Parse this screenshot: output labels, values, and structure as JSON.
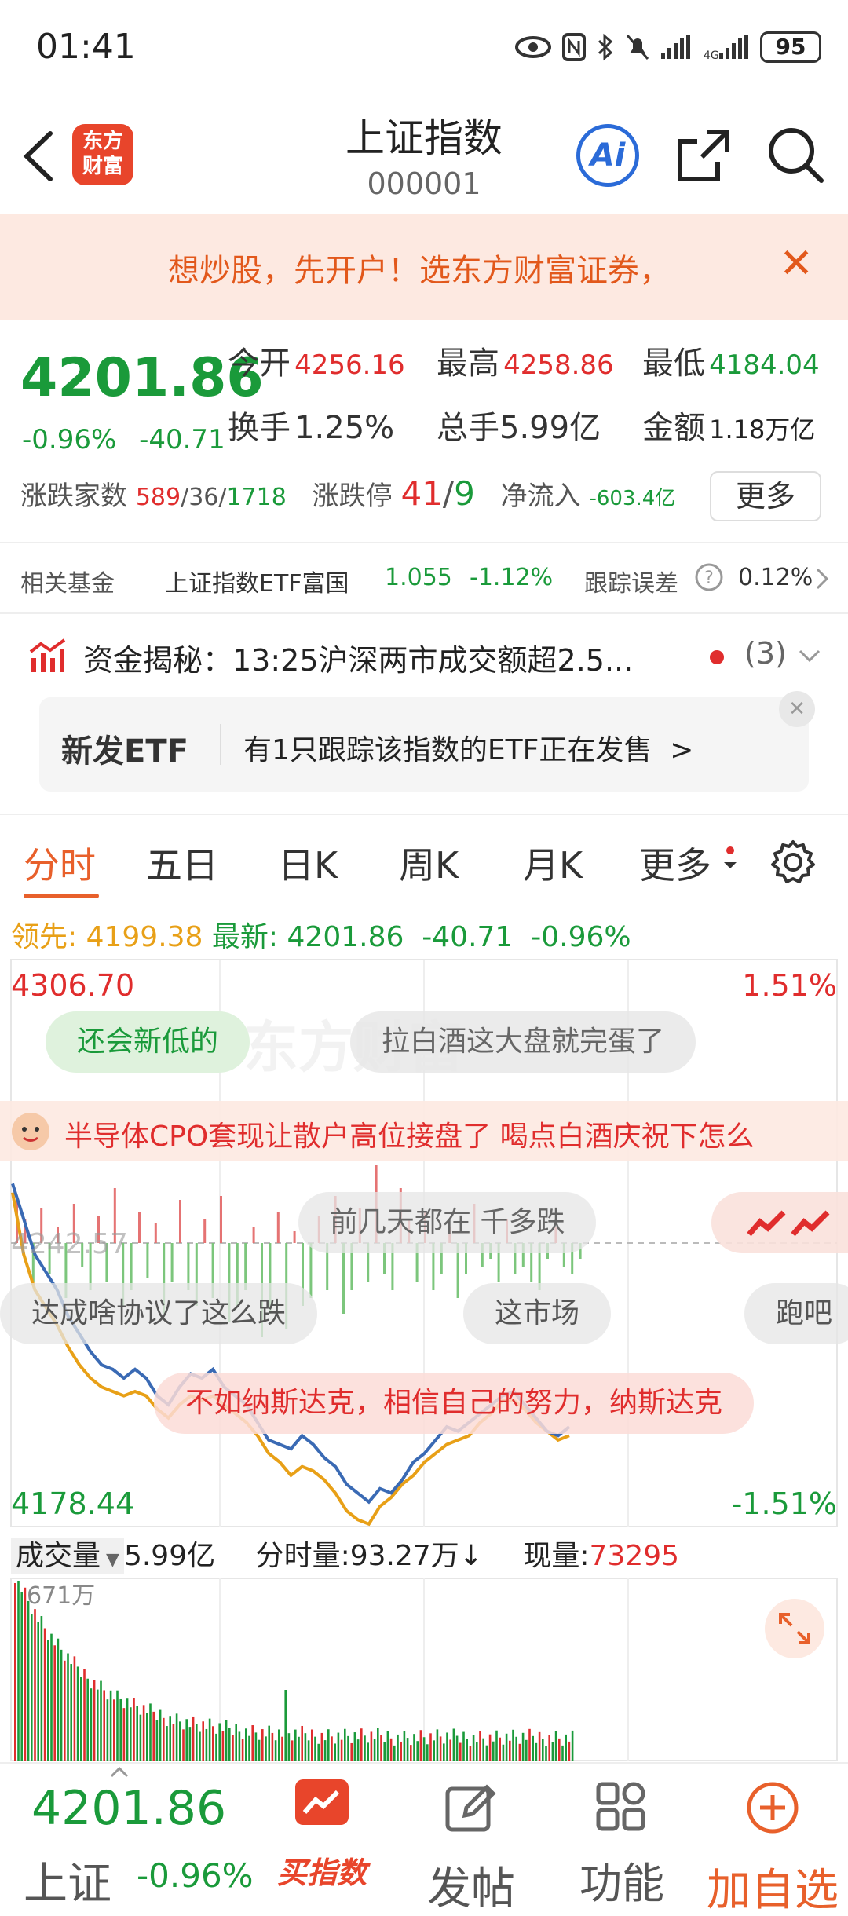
{
  "status_bar": {
    "time": "01:41",
    "battery": "95"
  },
  "header": {
    "title": "上证指数",
    "code": "000001",
    "logo_text_1": "东方",
    "logo_text_2": "财富",
    "ai_label": "Ai"
  },
  "banner": {
    "text": "想炒股，先开户！选东方财富证券，",
    "close": "✕"
  },
  "quote": {
    "price": "4201.86",
    "change_pct": "-0.96%",
    "change": "-40.71",
    "open_label": "今开",
    "open": "4256.16",
    "high_label": "最高",
    "high": "4258.86",
    "low_label": "最低",
    "low": "4184.04",
    "turnover_label": "换手",
    "turnover": "1.25%",
    "volume_label": "总手",
    "volume": "5.99亿",
    "amount_label": "金额",
    "amount": "1.18万亿",
    "adv_label": "涨跌家数",
    "adv_up": "589",
    "adv_flat": "36",
    "adv_down": "1718",
    "limit_label": "涨跌停",
    "limit_up": "41",
    "limit_down": "9",
    "netflow_label": "净流入",
    "netflow": "-603.4亿",
    "more": "更多"
  },
  "fund_row": {
    "label": "相关基金",
    "fund_name": "上证指数ETF富国",
    "price": "1.055",
    "change": "-1.12%",
    "track_label": "跟踪误差",
    "track_value": "0.12%"
  },
  "news_row": {
    "text": "资金揭秘：13:25沪深两市成交额超2.5...",
    "count": "(3)"
  },
  "etf_card": {
    "tag": "新发ETF",
    "text": "有1只跟踪该指数的ETF正在发售",
    "arrow": ">",
    "close": "✕"
  },
  "tabs": [
    "分时",
    "五日",
    "日K",
    "周K",
    "月K",
    "更多"
  ],
  "lead_row": {
    "lead_label": "领先:",
    "lead_value": "4199.38",
    "latest_label": "最新:",
    "latest_value": "4201.86",
    "change": "-40.71",
    "change_pct": "-0.96%"
  },
  "chart": {
    "y_top": "4306.70",
    "y_mid": "4242.57",
    "y_bottom": "4178.44",
    "pct_top": "1.51%",
    "pct_bottom": "-1.51%",
    "comments": [
      "还会新低的",
      "拉白酒这大盘就完蛋了",
      "半导体CPO套现让散户高位接盘了 喝点白酒庆祝下怎么",
      "前几天都在 千多跌",
      "达成啥协议了这么跌",
      "这市场",
      "跑吧",
      "不如纳斯达克，相信自己的努力，纳斯达克"
    ],
    "watermark": "东方财富"
  },
  "chart_data": {
    "type": "line",
    "series": [],
    "ylim": [
      4178.44,
      4306.7
    ],
    "prev_close": 4242.57,
    "price": [
      4256,
      4248,
      4240,
      4236,
      4232,
      4226,
      4222,
      4218,
      4215,
      4214,
      4212,
      4214,
      4212,
      4208,
      4206,
      4210,
      4213,
      4212,
      4214,
      4210,
      4208,
      4206,
      4202,
      4198,
      4197,
      4196,
      4199,
      4197,
      4194,
      4192,
      4188,
      4186,
      4184,
      4187,
      4186,
      4189,
      4193,
      4195,
      4198,
      4201,
      4200,
      4202,
      4204,
      4206,
      4208,
      4209,
      4206,
      4203,
      4200,
      4199,
      4201
    ],
    "avg": [
      4254,
      4240,
      4232,
      4228,
      4224,
      4219,
      4215,
      4212,
      4210,
      4209,
      4208,
      4209,
      4208,
      4205,
      4203,
      4206,
      4208,
      4207,
      4208,
      4206,
      4204,
      4202,
      4199,
      4195,
      4193,
      4190,
      4192,
      4191,
      4189,
      4186,
      4182,
      4180,
      4179,
      4183,
      4185,
      4188,
      4190,
      4193,
      4195,
      4197,
      4198,
      4199,
      4202,
      4204,
      4207,
      4207,
      4205,
      4202,
      4200,
      4198,
      4199
    ]
  },
  "volume": {
    "label": "成交量",
    "total": "5.99亿",
    "minute_vol": "分时量:93.27万↓",
    "current_label": "现量:",
    "current": "73295",
    "max": "671万"
  },
  "bottom_nav": {
    "price": "4201.86",
    "name": "上证",
    "change_pct": "-0.96%",
    "buy_label": "买指数",
    "post_label": "发帖",
    "func_label": "功能",
    "add_label": "加自选"
  },
  "colors": {
    "up": "#e02d2d",
    "down": "#1a9a3a",
    "accent": "#e8602b",
    "avg_line": "#e8a017",
    "price_line": "#3a6ab4"
  }
}
